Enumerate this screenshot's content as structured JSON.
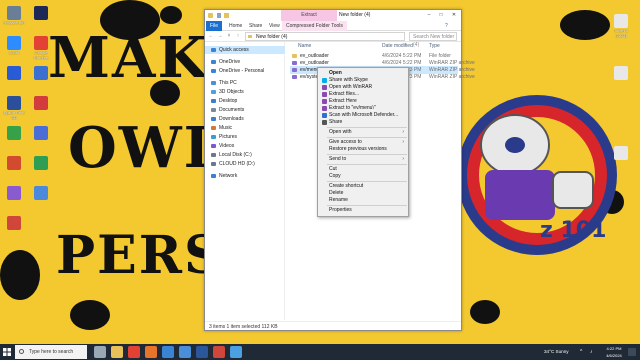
{
  "wallpaper": {
    "line1": "MAKE Y",
    "line2": "OWI",
    "line3": "PERSPEC",
    "logo_text": "z 101",
    "bg_color": "#f4c930"
  },
  "desktop_icons_left": [
    {
      "label": "Recycle Bin",
      "icon": "recycle-bin-icon",
      "color": "#6a7f96"
    },
    {
      "label": "",
      "icon": "app-icon",
      "color": "#1d2a56"
    },
    {
      "label": "Zoom",
      "icon": "zoom-icon",
      "color": "#2d8cff"
    },
    {
      "label": "Google Chrome",
      "icon": "chrome-icon",
      "color": "#e34133"
    },
    {
      "label": "",
      "icon": "app-icon",
      "color": "#2a5bd7"
    },
    {
      "label": "",
      "icon": "app-icon",
      "color": "#3b6fd0"
    },
    {
      "label": "Epson Print CD",
      "icon": "epson-icon",
      "color": "#2b4f9a"
    },
    {
      "label": "",
      "icon": "app-icon",
      "color": "#d23c3c"
    },
    {
      "label": "",
      "icon": "app-icon",
      "color": "#36a148"
    },
    {
      "label": "",
      "icon": "app-icon",
      "color": "#4a6dd8"
    },
    {
      "label": "",
      "icon": "app-icon",
      "color": "#d34b2f"
    },
    {
      "label": "",
      "icon": "app-icon",
      "color": "#2f9e52"
    },
    {
      "label": "",
      "icon": "app-icon",
      "color": "#8a5bd0"
    },
    {
      "label": "",
      "icon": "app-icon",
      "color": "#4b89dc"
    },
    {
      "label": "",
      "icon": "app-icon",
      "color": "#d0463a"
    }
  ],
  "desktop_icons_right": [
    {
      "label": "Token 5 (2024)",
      "icon": "document-icon",
      "color": "#e8e8e8"
    },
    {
      "label": "",
      "icon": "document-icon",
      "color": "#e8e8e8"
    },
    {
      "label": "",
      "icon": "document-icon",
      "color": "#e8e8e8"
    }
  ],
  "explorer": {
    "title": "New folder (4)",
    "context_tab_top": "Extract",
    "tabs": [
      "File",
      "Home",
      "Share",
      "View",
      "Compressed Folder Tools"
    ],
    "address": "New folder (4)",
    "search_placeholder": "Search New folder (4)",
    "nav": [
      {
        "label": "Quick access",
        "icon": "star-icon",
        "color": "#3a84d6",
        "selected": true
      },
      {
        "label": "OneDrive",
        "icon": "cloud-icon",
        "color": "#3a84d6"
      },
      {
        "label": "OneDrive - Personal",
        "icon": "cloud-icon",
        "color": "#3a84d6"
      },
      {
        "label": "This PC",
        "icon": "pc-icon",
        "color": "#4a90d9"
      },
      {
        "label": "3D Objects",
        "icon": "cube-icon",
        "color": "#4aa0e0"
      },
      {
        "label": "Desktop",
        "icon": "desktop-icon",
        "color": "#3a7fd0"
      },
      {
        "label": "Documents",
        "icon": "document-icon",
        "color": "#7a8a9a"
      },
      {
        "label": "Downloads",
        "icon": "download-icon",
        "color": "#3a7fd0"
      },
      {
        "label": "Music",
        "icon": "music-icon",
        "color": "#d07a3a"
      },
      {
        "label": "Pictures",
        "icon": "picture-icon",
        "color": "#3a9fd0"
      },
      {
        "label": "Videos",
        "icon": "video-icon",
        "color": "#7a5ad0"
      },
      {
        "label": "Local Disk (C:)",
        "icon": "disk-icon",
        "color": "#6a7a8a"
      },
      {
        "label": "CLOUD HD (D:)",
        "icon": "disk-icon",
        "color": "#6a7a8a"
      },
      {
        "label": "Network",
        "icon": "network-icon",
        "color": "#3a7fd0"
      }
    ],
    "columns": [
      "Name",
      "Date modified",
      "Type"
    ],
    "files": [
      {
        "name": "ev_outloader",
        "date": "4/6/2024 5:22 PM",
        "type": "File folder",
        "icon": "folder-icon",
        "color": "#e8c15a",
        "selected": false
      },
      {
        "name": "ev_outloader",
        "date": "4/6/2024 5:22 PM",
        "type": "WinRAR ZIP archive",
        "icon": "zip-icon",
        "color": "#8a6bd0",
        "selected": false
      },
      {
        "name": "ev/menu",
        "date": "4/6/2024 5:23 PM",
        "type": "WinRAR ZIP archive",
        "icon": "zip-icon",
        "color": "#8a6bd0",
        "selected": true
      },
      {
        "name": "ev/system",
        "date": "4/6/2024 5:23 PM",
        "type": "WinRAR ZIP archive",
        "icon": "zip-icon",
        "color": "#8a6bd0",
        "selected": false
      }
    ],
    "status": "3 items    1 item selected  112 KB"
  },
  "context_menu": [
    {
      "label": "Open",
      "bold": true,
      "icon": "",
      "sub": false
    },
    {
      "label": "Share with Skype",
      "icon": "skype-icon",
      "color": "#00aff0",
      "sub": false
    },
    {
      "label": "Open with WinRAR",
      "icon": "winrar-icon",
      "color": "#8a4bb0",
      "sub": false
    },
    {
      "label": "Extract files...",
      "icon": "winrar-icon",
      "color": "#8a4bb0",
      "sub": false
    },
    {
      "label": "Extract Here",
      "icon": "winrar-icon",
      "color": "#8a4bb0",
      "sub": false
    },
    {
      "label": "Extract to \"ev/menu\\\"",
      "icon": "winrar-icon",
      "color": "#8a4bb0",
      "sub": false
    },
    {
      "label": "Scan with Microsoft Defender...",
      "icon": "defender-icon",
      "color": "#2f6fd0",
      "sub": false
    },
    {
      "label": "Share",
      "icon": "share-icon",
      "color": "#555555",
      "sub": false
    },
    {
      "sep": true
    },
    {
      "label": "Open with",
      "icon": "",
      "sub": true
    },
    {
      "sep": true
    },
    {
      "label": "Give access to",
      "icon": "",
      "sub": true
    },
    {
      "label": "Restore previous versions",
      "icon": "",
      "sub": false
    },
    {
      "sep": true
    },
    {
      "label": "Send to",
      "icon": "",
      "sub": true
    },
    {
      "sep": true
    },
    {
      "label": "Cut",
      "icon": "",
      "sub": false
    },
    {
      "label": "Copy",
      "icon": "",
      "sub": false
    },
    {
      "sep": true
    },
    {
      "label": "Create shortcut",
      "icon": "",
      "sub": false
    },
    {
      "label": "Delete",
      "icon": "",
      "sub": false
    },
    {
      "label": "Rename",
      "icon": "",
      "sub": false
    },
    {
      "sep": true
    },
    {
      "label": "Properties",
      "icon": "",
      "sub": false
    }
  ],
  "taskbar": {
    "search_placeholder": "Type here to search",
    "apps": [
      {
        "icon": "task-view-icon",
        "color": "#9aa7b5"
      },
      {
        "icon": "file-explorer-icon",
        "color": "#e8c15a"
      },
      {
        "icon": "chrome-icon",
        "color": "#e34133"
      },
      {
        "icon": "firefox-icon",
        "color": "#e8732a"
      },
      {
        "icon": "mail-icon",
        "color": "#3a84d6"
      },
      {
        "icon": "store-icon",
        "color": "#4a8fd8"
      },
      {
        "icon": "word-icon",
        "color": "#2b579a"
      },
      {
        "icon": "app-icon",
        "color": "#d0463a"
      },
      {
        "icon": "app-icon",
        "color": "#4aa0e0"
      }
    ],
    "weather": "34°C  Sunny",
    "time": "4:22 PM",
    "date": "4/6/2024"
  }
}
